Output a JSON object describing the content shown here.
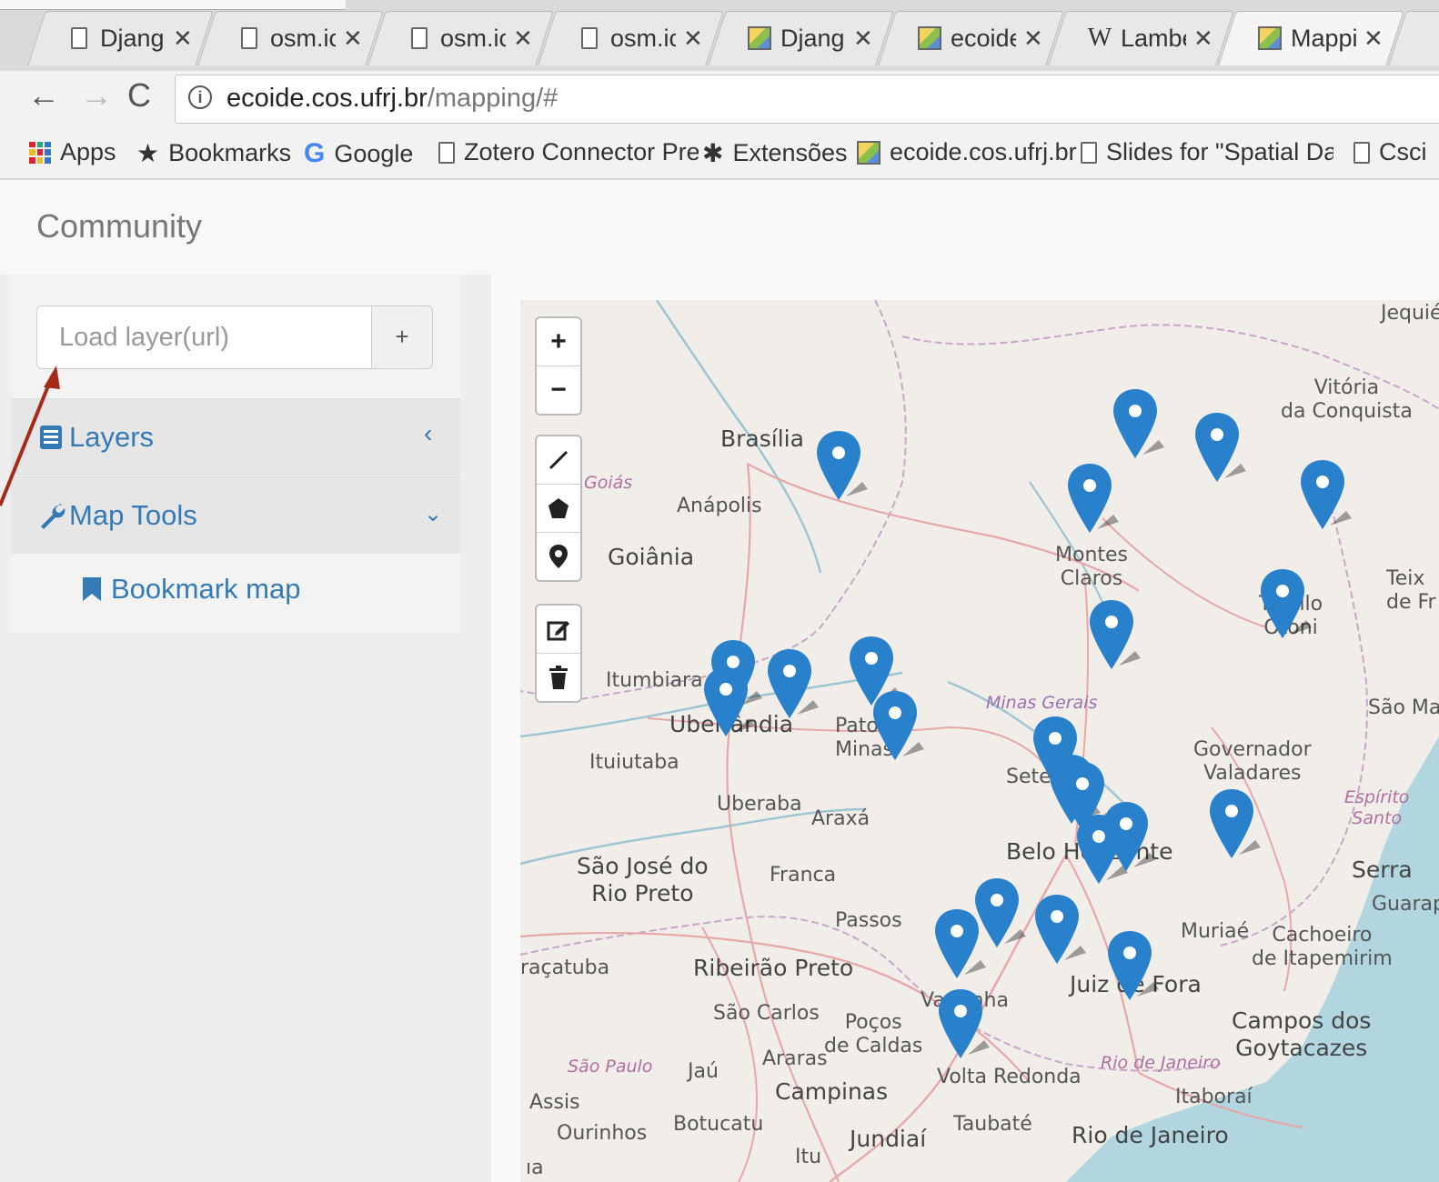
{
  "browser": {
    "tabs": [
      {
        "label": "Djang",
        "icon": "doc-icon"
      },
      {
        "label": "osm.ic",
        "icon": "doc-icon"
      },
      {
        "label": "osm.ic",
        "icon": "doc-icon"
      },
      {
        "label": "osm.ic",
        "icon": "doc-icon"
      },
      {
        "label": "Djang",
        "icon": "site-icon"
      },
      {
        "label": "ecoide",
        "icon": "site-icon"
      },
      {
        "label": "Lambe",
        "icon": "wikipedia-icon"
      },
      {
        "label": "Mappi",
        "icon": "site-icon",
        "active": true
      }
    ],
    "tab_close": "✕",
    "url_host": "ecoide.cos.ufrj.br",
    "url_path": "/mapping/#",
    "bookmarks": {
      "apps": "Apps",
      "bookmarks": "Bookmarks",
      "google": "Google",
      "zotero": "Zotero Connector Pre",
      "extensoes": "Extensões",
      "ecoide": "ecoide.cos.ufrj.br",
      "slides": "Slides for \"Spatial Dat",
      "csci": "Csci"
    }
  },
  "page": {
    "brand": "Community",
    "load_layer_placeholder": "Load layer(url)",
    "load_layer_button": "+",
    "panels": {
      "layers": "Layers",
      "map_tools": "Map Tools",
      "bookmark_map": "Bookmark map"
    }
  },
  "map": {
    "controls": {
      "zoom_in": "+",
      "zoom_out": "−"
    },
    "cities": {
      "jequie": "Jequié",
      "vitoria": "Vitória\nda Conquista",
      "brasilia": "Brasília",
      "goias": "Goiás",
      "anapolis": "Anápolis",
      "goiania": "Goiânia",
      "montes": "Montes\nClaros",
      "teix": "Teix\nde Fr",
      "teofilo": "Teófilo\nOtoni",
      "itumbiara": "Itumbiara",
      "uberlandia": "Uberlândia",
      "patos": "Patos\nMinas",
      "minas": "Minas Gerais",
      "saoma": "São Ma",
      "ituiutaba": "Ituiutaba",
      "sete": "Sete",
      "governador": "Governador\nValadares",
      "uberaba": "Uberaba",
      "araxa": "Araxá",
      "espirito": "Espírito\nSanto",
      "bh": "Belo Horizonte",
      "sjrp": "São José do\nRio Preto",
      "franca": "Franca",
      "serra": "Serra",
      "guarap": "Guarap",
      "passos": "Passos",
      "muriae": "Muriaé",
      "cachoeiro": "Cachoeiro\nde Itapemirim",
      "aracatuba": "raçatuba",
      "ribeirao": "Ribeirão Preto",
      "juiz": "Juiz de Fora",
      "varginha": "Varginha",
      "saocarlos": "São Carlos",
      "pocos": "Poços\nde Caldas",
      "campos": "Campos dos\nGoytacazes",
      "saopaulo": "São Paulo",
      "jau": "Jaú",
      "araras": "Araras",
      "voltaredonda": "Volta Redonda",
      "riodejaneiro_state": "Rio de Janeiro",
      "itaborai": "Itaboraí",
      "campinas": "Campinas",
      "assis": "Assis",
      "botucatu": "Botucatu",
      "taubate": "Taubaté",
      "riodejaneiro": "Rio de Janeiro",
      "ourinhos": "Ourinhos",
      "jundiai": "Jundiaí",
      "itu": "Itu",
      "ia": "ıa"
    },
    "marker_color": "#2a81cb"
  }
}
